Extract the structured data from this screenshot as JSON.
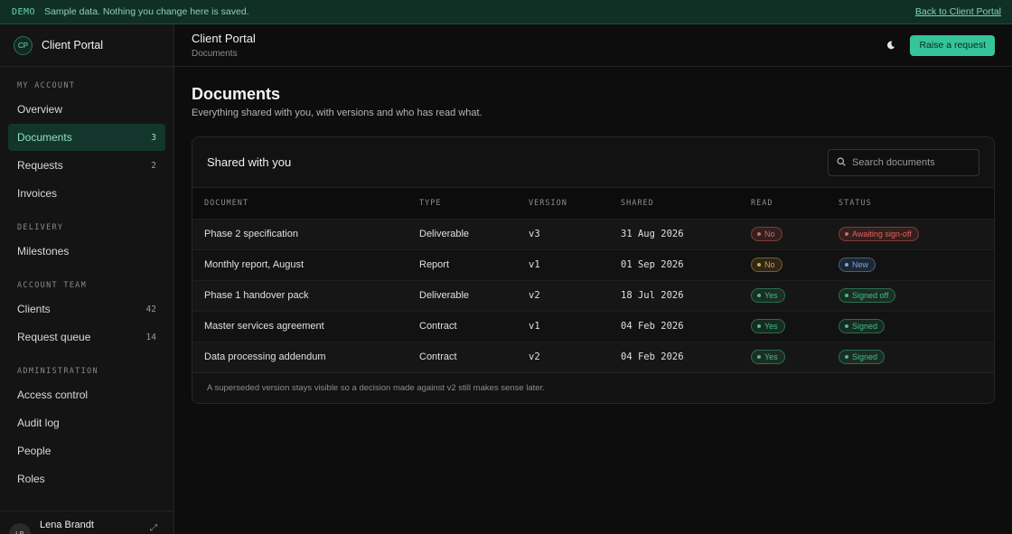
{
  "banner": {
    "tag": "DEMO",
    "message": "Sample data. Nothing you change here is saved.",
    "back_link": "Back to Client Portal"
  },
  "sidebar": {
    "brand_initials": "CP",
    "brand_name": "Client Portal",
    "sections": [
      {
        "label": "MY ACCOUNT",
        "items": [
          {
            "label": "Overview",
            "count": ""
          },
          {
            "label": "Documents",
            "count": "3",
            "active": true
          },
          {
            "label": "Requests",
            "count": "2"
          },
          {
            "label": "Invoices",
            "count": ""
          }
        ]
      },
      {
        "label": "DELIVERY",
        "items": [
          {
            "label": "Milestones",
            "count": ""
          }
        ]
      },
      {
        "label": "ACCOUNT TEAM",
        "items": [
          {
            "label": "Clients",
            "count": "42"
          },
          {
            "label": "Request queue",
            "count": "14"
          }
        ]
      },
      {
        "label": "ADMINISTRATION",
        "items": [
          {
            "label": "Access control",
            "count": ""
          },
          {
            "label": "Audit log",
            "count": ""
          },
          {
            "label": "People",
            "count": ""
          },
          {
            "label": "Roles",
            "count": ""
          }
        ]
      }
    ],
    "user": {
      "initials": "LB",
      "name": "Lena Brandt"
    }
  },
  "header": {
    "title": "Client Portal",
    "breadcrumb": "Documents",
    "theme_icon": "moon-icon",
    "raise_label": "Raise a request"
  },
  "page": {
    "title": "Documents",
    "subtitle": "Everything shared with you, with versions and who has read what."
  },
  "card": {
    "title": "Shared with you",
    "search_placeholder": "Search documents",
    "columns": [
      "DOCUMENT",
      "TYPE",
      "VERSION",
      "SHARED",
      "READ",
      "STATUS"
    ],
    "rows": [
      {
        "document": "Phase 2 specification",
        "type": "Deliverable",
        "version": "v3",
        "shared": "31 Aug 2026",
        "read": "No",
        "status": "Awaiting sign-off"
      },
      {
        "document": "Monthly report, August",
        "type": "Report",
        "version": "v1",
        "shared": "01 Sep 2026",
        "read": "No",
        "status": "New"
      },
      {
        "document": "Phase 1 handover pack",
        "type": "Deliverable",
        "version": "v2",
        "shared": "18 Jul 2026",
        "read": "Yes",
        "status": "Signed off"
      },
      {
        "document": "Master services agreement",
        "type": "Contract",
        "version": "v1",
        "shared": "04 Feb 2026",
        "read": "Yes",
        "status": "Signed"
      },
      {
        "document": "Data processing addendum",
        "type": "Contract",
        "version": "v2",
        "shared": "04 Feb 2026",
        "read": "Yes",
        "status": "Signed"
      }
    ],
    "footnote": "A superseded version stays visible so a decision made against v2 still makes sense later."
  },
  "colors": {
    "accent": "#36c49a",
    "active_nav_bg": "#12362b",
    "pill_red": "#e0605a",
    "pill_amber": "#d9a43a",
    "pill_green": "#3fbf86",
    "pill_blue": "#6aa8e8"
  }
}
